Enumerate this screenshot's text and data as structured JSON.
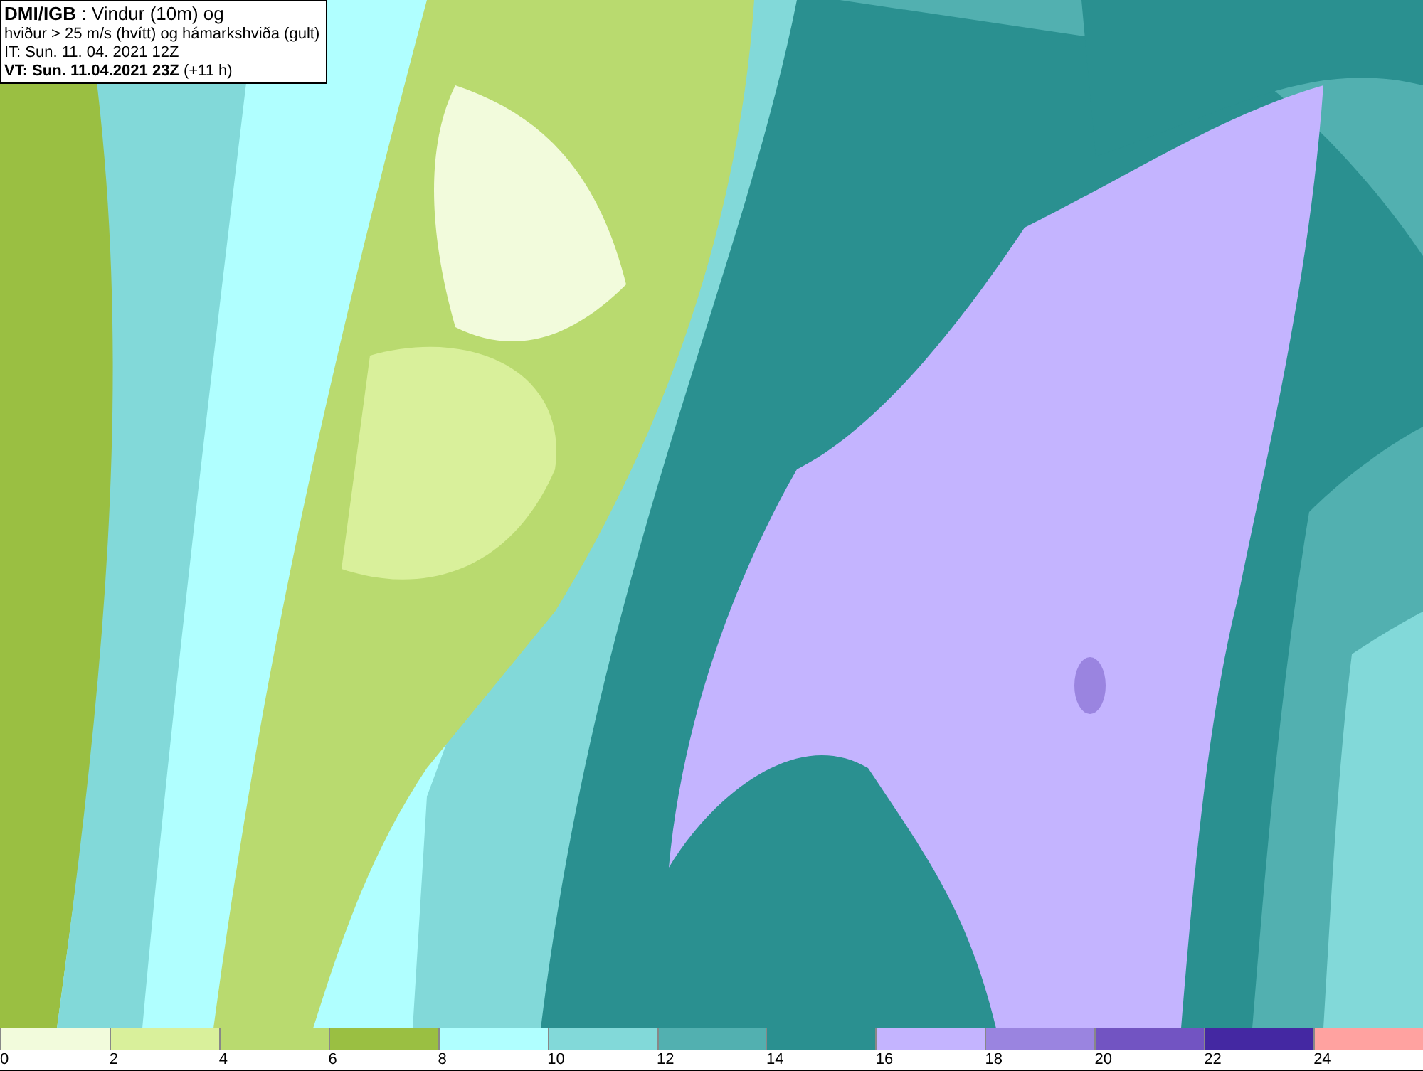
{
  "title_box": {
    "lines": [
      "**DMI/IGB** : Vindur (10m) og",
      "hviður > 25 m/s (hvítt) og hámarkshviða (gult)",
      "IT: Sun. 11. 04. 2021 12Z",
      "**VT: Sun. 11.04.2021 23Z** (+11 h)"
    ]
  },
  "legend": {
    "bins": [
      {
        "label": "0",
        "color": "#f2fbdc"
      },
      {
        "label": "2",
        "color": "#d9f09b"
      },
      {
        "label": "4",
        "color": "#b9da6f"
      },
      {
        "label": "6",
        "color": "#9abf42"
      },
      {
        "label": "8",
        "color": "#b0ffff"
      },
      {
        "label": "10",
        "color": "#82d9d9"
      },
      {
        "label": "12",
        "color": "#52b0b0"
      },
      {
        "label": "14",
        "color": "#2a9090"
      },
      {
        "label": "16",
        "color": "#c4b4ff"
      },
      {
        "label": "18",
        "color": "#9a84e0"
      },
      {
        "label": "20",
        "color": "#7254c2"
      },
      {
        "label": "22",
        "color": "#4428a2"
      },
      {
        "label": "24",
        "color": "#ffa2a0"
      }
    ]
  }
}
